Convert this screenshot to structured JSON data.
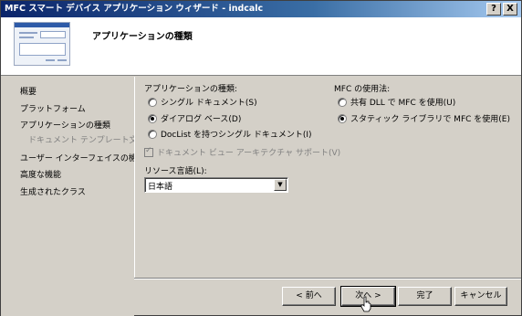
{
  "window": {
    "title": "MFC スマート デバイス アプリケーション ウィザード - indcalc",
    "help_button": "?",
    "close_button": "X"
  },
  "header": {
    "title": "アプリケーションの種類"
  },
  "sidebar": {
    "items": [
      {
        "label": "概要"
      },
      {
        "label": "プラットフォーム"
      },
      {
        "label": "アプリケーションの種類"
      },
      {
        "label": "ドキュメント テンプレート文字列"
      },
      {
        "label": "ユーザー インターフェイスの機能"
      },
      {
        "label": "高度な機能"
      },
      {
        "label": "生成されたクラス"
      }
    ]
  },
  "app_type": {
    "heading": "アプリケーションの種類:",
    "options": [
      {
        "label": "シングル ドキュメント(S)",
        "selected": false
      },
      {
        "label": "ダイアログ ベース(D)",
        "selected": true
      },
      {
        "label": "DocList を持つシングル ドキュメント(I)",
        "selected": false
      }
    ],
    "doc_view_support": "ドキュメント ビュー アーキテクチャ サポート(V)"
  },
  "mfc_usage": {
    "heading": "MFC の使用法:",
    "options": [
      {
        "label": "共有 DLL で MFC を使用(U)",
        "selected": false
      },
      {
        "label": "スタティック ライブラリで MFC を使用(E)",
        "selected": true
      }
    ]
  },
  "resource_language": {
    "label": "リソース言語(L):",
    "value": "日本語"
  },
  "buttons": {
    "back": "< 前へ",
    "next": "次へ >",
    "finish": "完了",
    "cancel": "キャンセル"
  }
}
